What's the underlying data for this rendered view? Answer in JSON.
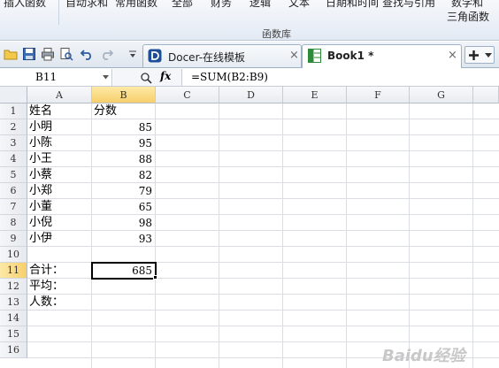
{
  "ribbon": {
    "items": [
      "插入函数",
      "自动求和",
      "常用函数",
      "全部",
      "财务",
      "逻辑",
      "文本",
      "日期和时间",
      "查找与引用",
      "数学和"
    ],
    "group_label": "函数库",
    "trig_label": "三角函数"
  },
  "tabs": [
    {
      "title": "Docer-在线模板",
      "close": "×",
      "icon": "docer-icon"
    },
    {
      "title": "Book1 *",
      "close": "×",
      "icon": "spreadsheet-icon"
    }
  ],
  "formula_bar": {
    "name_box": "B11",
    "fx_label": "fx",
    "formula": "=SUM(B2:B9)"
  },
  "sheet": {
    "columns": [
      "A",
      "B",
      "C",
      "D",
      "E",
      "F",
      "G"
    ],
    "rows": [
      "1",
      "2",
      "3",
      "4",
      "5",
      "6",
      "7",
      "8",
      "9",
      "10",
      "11",
      "12",
      "13",
      "14",
      "15",
      "16"
    ],
    "cells": {
      "A1": "姓名",
      "B1": "分数",
      "A2": "小明",
      "B2": "85",
      "A3": "小陈",
      "B3": "95",
      "A4": "小王",
      "B4": "88",
      "A5": "小蔡",
      "B5": "82",
      "A6": "小郑",
      "B6": "79",
      "A7": "小董",
      "B7": "65",
      "A8": "小倪",
      "B8": "98",
      "A9": "小伊",
      "B9": "93",
      "A11": "合计：",
      "B11": "685",
      "A12": "平均：",
      "A13": "人数："
    },
    "selected_cell": "B11"
  },
  "watermark": "Baidu经验",
  "colors": {
    "selected_header": "#f7cf6b",
    "grid_line": "#dadde2",
    "ribbon_bg": "#e3eaf4"
  }
}
